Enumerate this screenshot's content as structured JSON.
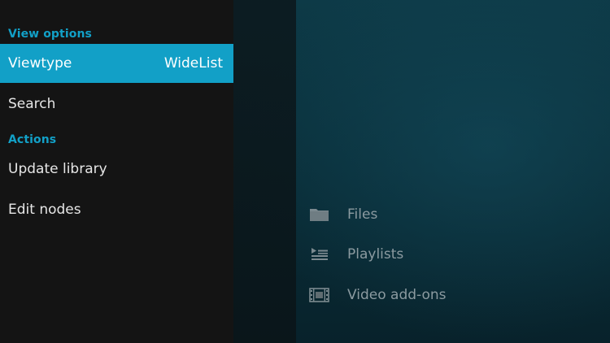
{
  "side_menu": {
    "view_options_label": "View options",
    "viewtype": {
      "label": "Viewtype",
      "value": "WideList"
    },
    "search_label": "Search",
    "actions_label": "Actions",
    "update_library_label": "Update library",
    "edit_nodes_label": "Edit nodes"
  },
  "content": {
    "items": [
      {
        "label": "Files",
        "icon": "folder-icon"
      },
      {
        "label": "Playlists",
        "icon": "playlist-icon"
      },
      {
        "label": "Video add-ons",
        "icon": "film-strip-icon"
      }
    ]
  },
  "colors": {
    "accent": "#12a0c7",
    "panel": "#141414",
    "background": "#0b2f3a"
  }
}
